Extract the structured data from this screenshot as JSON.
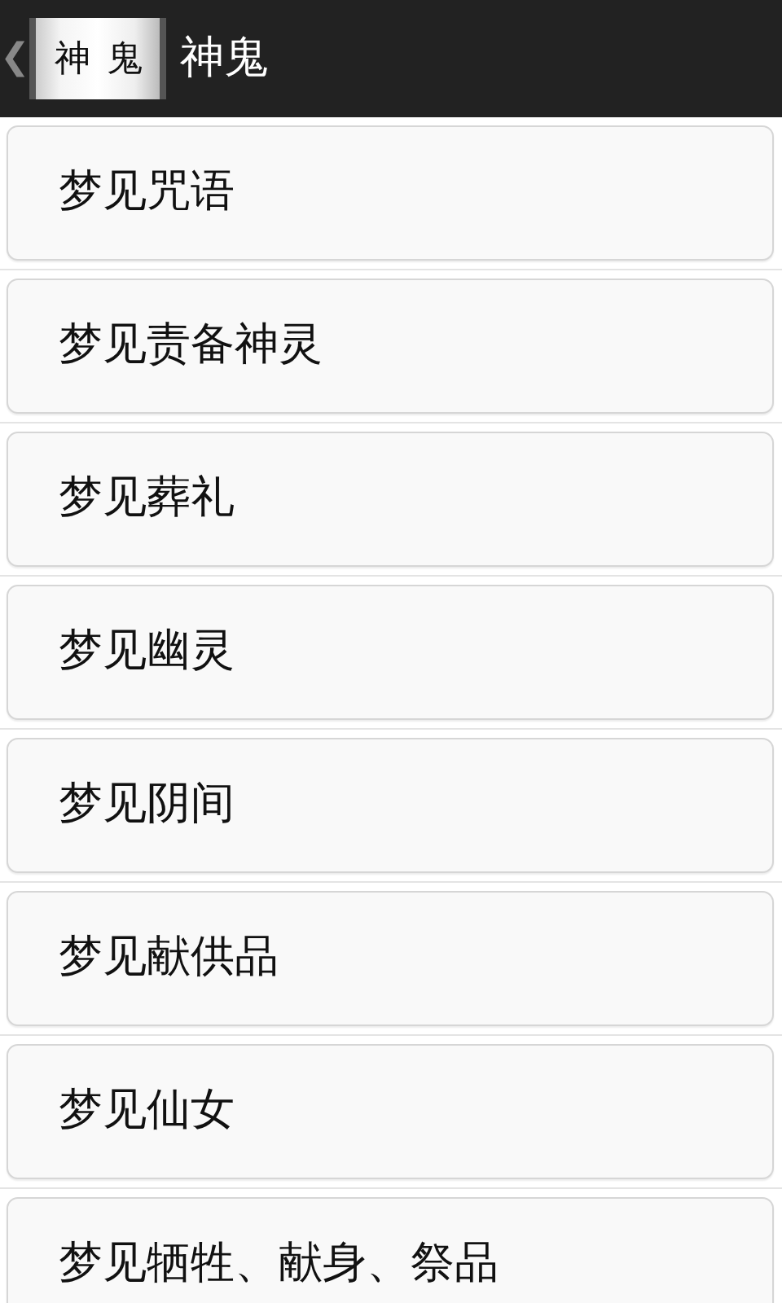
{
  "header": {
    "back": "❮",
    "logo_text": "神鬼",
    "title": "神鬼"
  },
  "items": [
    {
      "label": "梦见咒语"
    },
    {
      "label": "梦见责备神灵"
    },
    {
      "label": "梦见葬礼"
    },
    {
      "label": "梦见幽灵"
    },
    {
      "label": "梦见阴间"
    },
    {
      "label": "梦见献供品"
    },
    {
      "label": "梦见仙女"
    },
    {
      "label": "梦见牺牲、献身、祭品"
    }
  ]
}
